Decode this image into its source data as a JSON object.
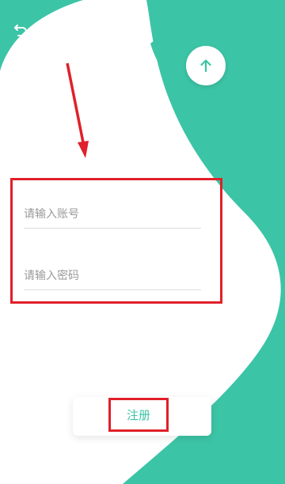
{
  "colors": {
    "accent": "#3cc4a6",
    "annotation": "#e0202a",
    "background": "#ffffff"
  },
  "header": {
    "back_icon": "back-arrow-icon",
    "register_label": "注册",
    "up_icon": "arrow-up-icon"
  },
  "form": {
    "account_placeholder": "请输入账号",
    "password_placeholder": "请输入密码"
  },
  "footer": {
    "register_button_label": "注册"
  }
}
